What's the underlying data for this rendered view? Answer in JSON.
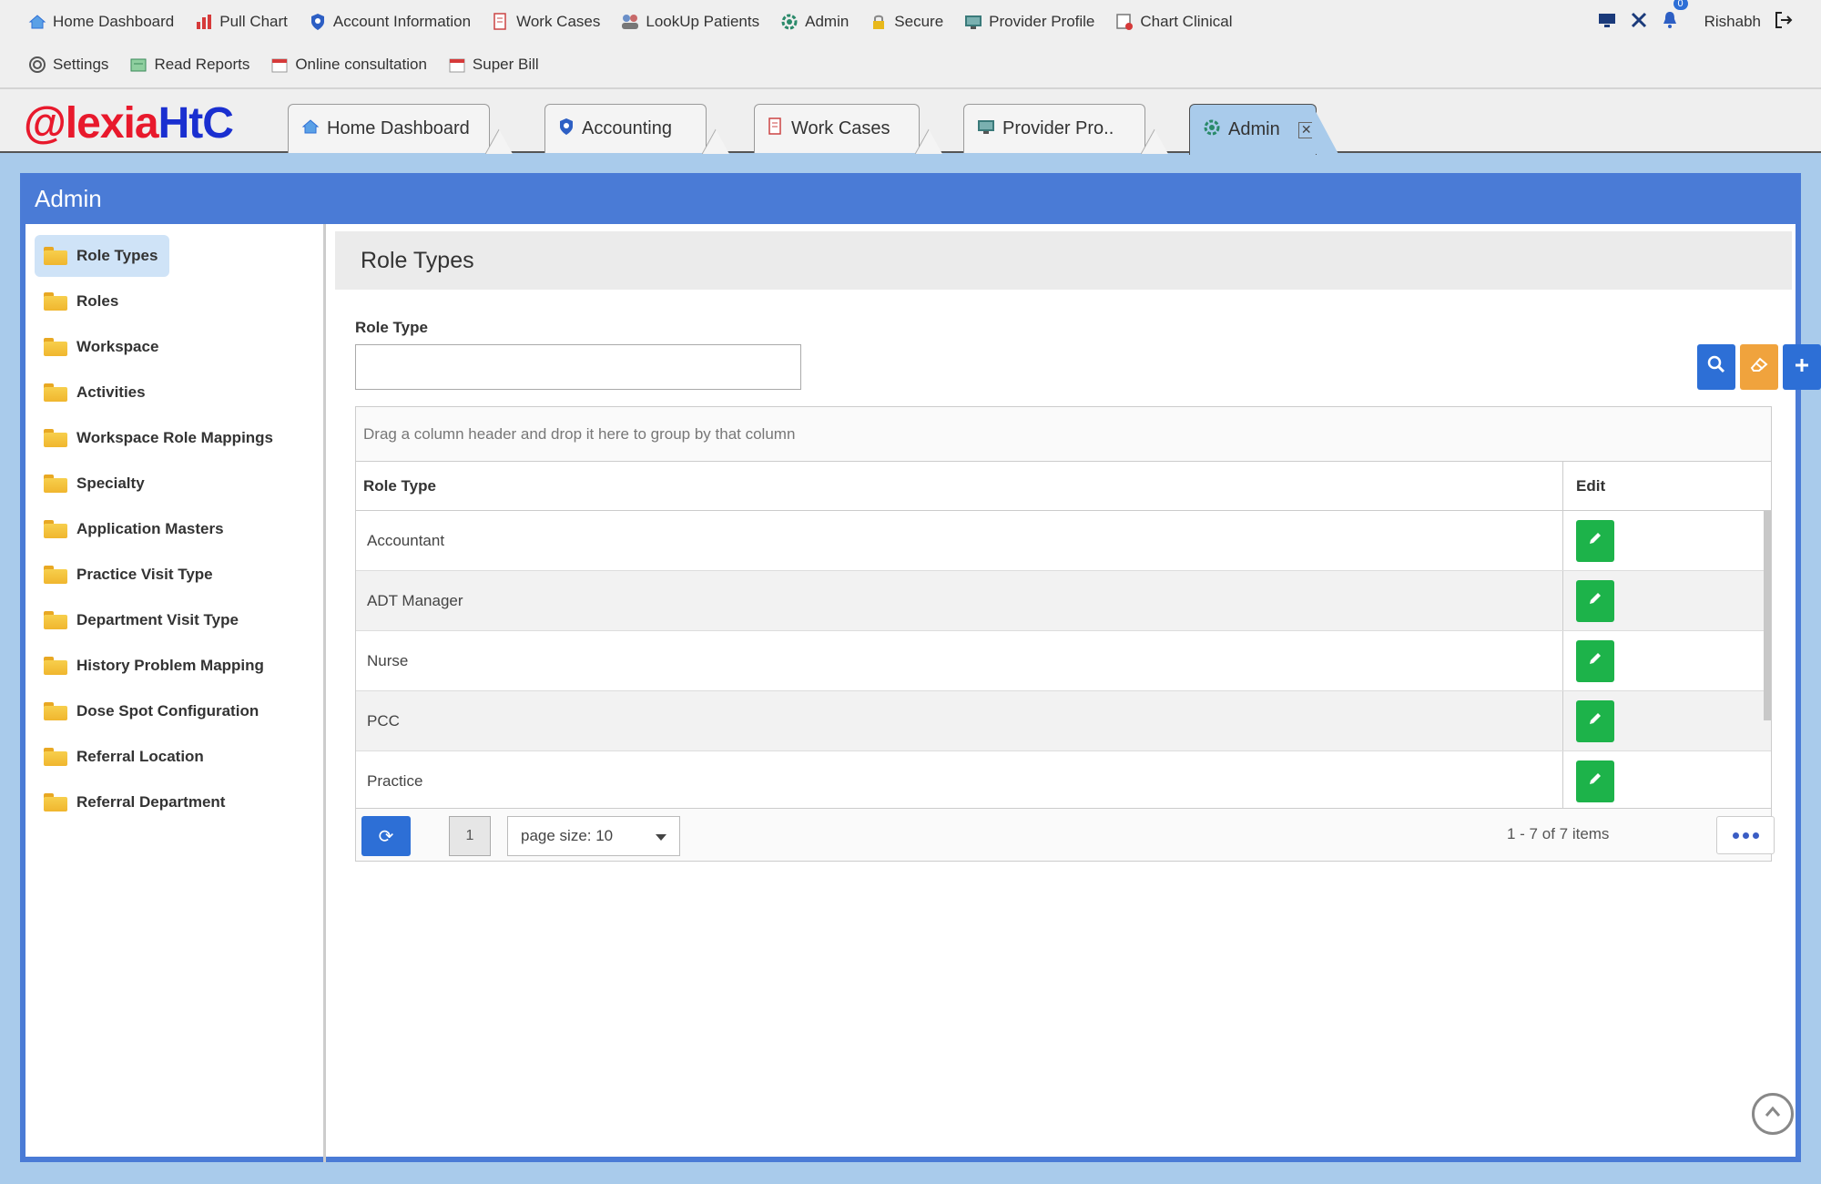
{
  "topnav": {
    "row1": [
      {
        "label": "Home Dashboard",
        "icon": "home-icon"
      },
      {
        "label": "Pull Chart",
        "icon": "bar-chart-icon"
      },
      {
        "label": "Account Information",
        "icon": "shield-icon"
      },
      {
        "label": "Work Cases",
        "icon": "document-icon"
      },
      {
        "label": "LookUp Patients",
        "icon": "patients-icon"
      },
      {
        "label": "Admin",
        "icon": "gear-icon"
      },
      {
        "label": "Secure",
        "icon": "lock-icon"
      },
      {
        "label": "Provider Profile",
        "icon": "monitor-icon"
      },
      {
        "label": "Chart Clinical",
        "icon": "chart-clinical-icon"
      }
    ],
    "row2": [
      {
        "label": "Settings",
        "icon": "settings-icon"
      },
      {
        "label": "Read Reports",
        "icon": "reports-icon"
      },
      {
        "label": "Online consultation",
        "icon": "calendar-icon"
      },
      {
        "label": "Super Bill",
        "icon": "calendar-icon"
      }
    ],
    "notification_count": "0",
    "user_name": "Rishabh"
  },
  "logo": {
    "part1": "@lexia",
    "part2": "HtC"
  },
  "tabs": [
    {
      "label": "Home Dashboard",
      "icon": "home-icon"
    },
    {
      "label": "Accounting",
      "icon": "shield-icon"
    },
    {
      "label": "Work Cases",
      "icon": "document-icon"
    },
    {
      "label": "Provider Pro..",
      "icon": "monitor-icon"
    },
    {
      "label": "Admin",
      "icon": "gear-icon",
      "active": true
    }
  ],
  "panel": {
    "title": "Admin"
  },
  "sidebar": {
    "items": [
      {
        "label": "Role Types",
        "active": true
      },
      {
        "label": "Roles"
      },
      {
        "label": "Workspace"
      },
      {
        "label": "Activities"
      },
      {
        "label": "Workspace Role Mappings"
      },
      {
        "label": "Specialty"
      },
      {
        "label": "Application Masters"
      },
      {
        "label": "Practice Visit Type"
      },
      {
        "label": "Department Visit Type"
      },
      {
        "label": "History Problem Mapping"
      },
      {
        "label": "Dose Spot Configuration"
      },
      {
        "label": "Referral Location"
      },
      {
        "label": "Referral Department"
      }
    ]
  },
  "main": {
    "title": "Role Types",
    "field_label": "Role Type",
    "field_value": "",
    "grid": {
      "group_hint": "Drag a column header and drop it here to group by that column",
      "columns": [
        "Role Type",
        "Edit"
      ],
      "rows": [
        "Accountant",
        "ADT Manager",
        "Nurse",
        "PCC",
        "Practice"
      ],
      "page": "1",
      "page_size": "page size: 10",
      "items_count": "1 - 7 of 7 items"
    }
  },
  "colors": {
    "primary": "#4a7bd6",
    "edit_green": "#1db34a",
    "clear_orange": "#f0a33d"
  }
}
